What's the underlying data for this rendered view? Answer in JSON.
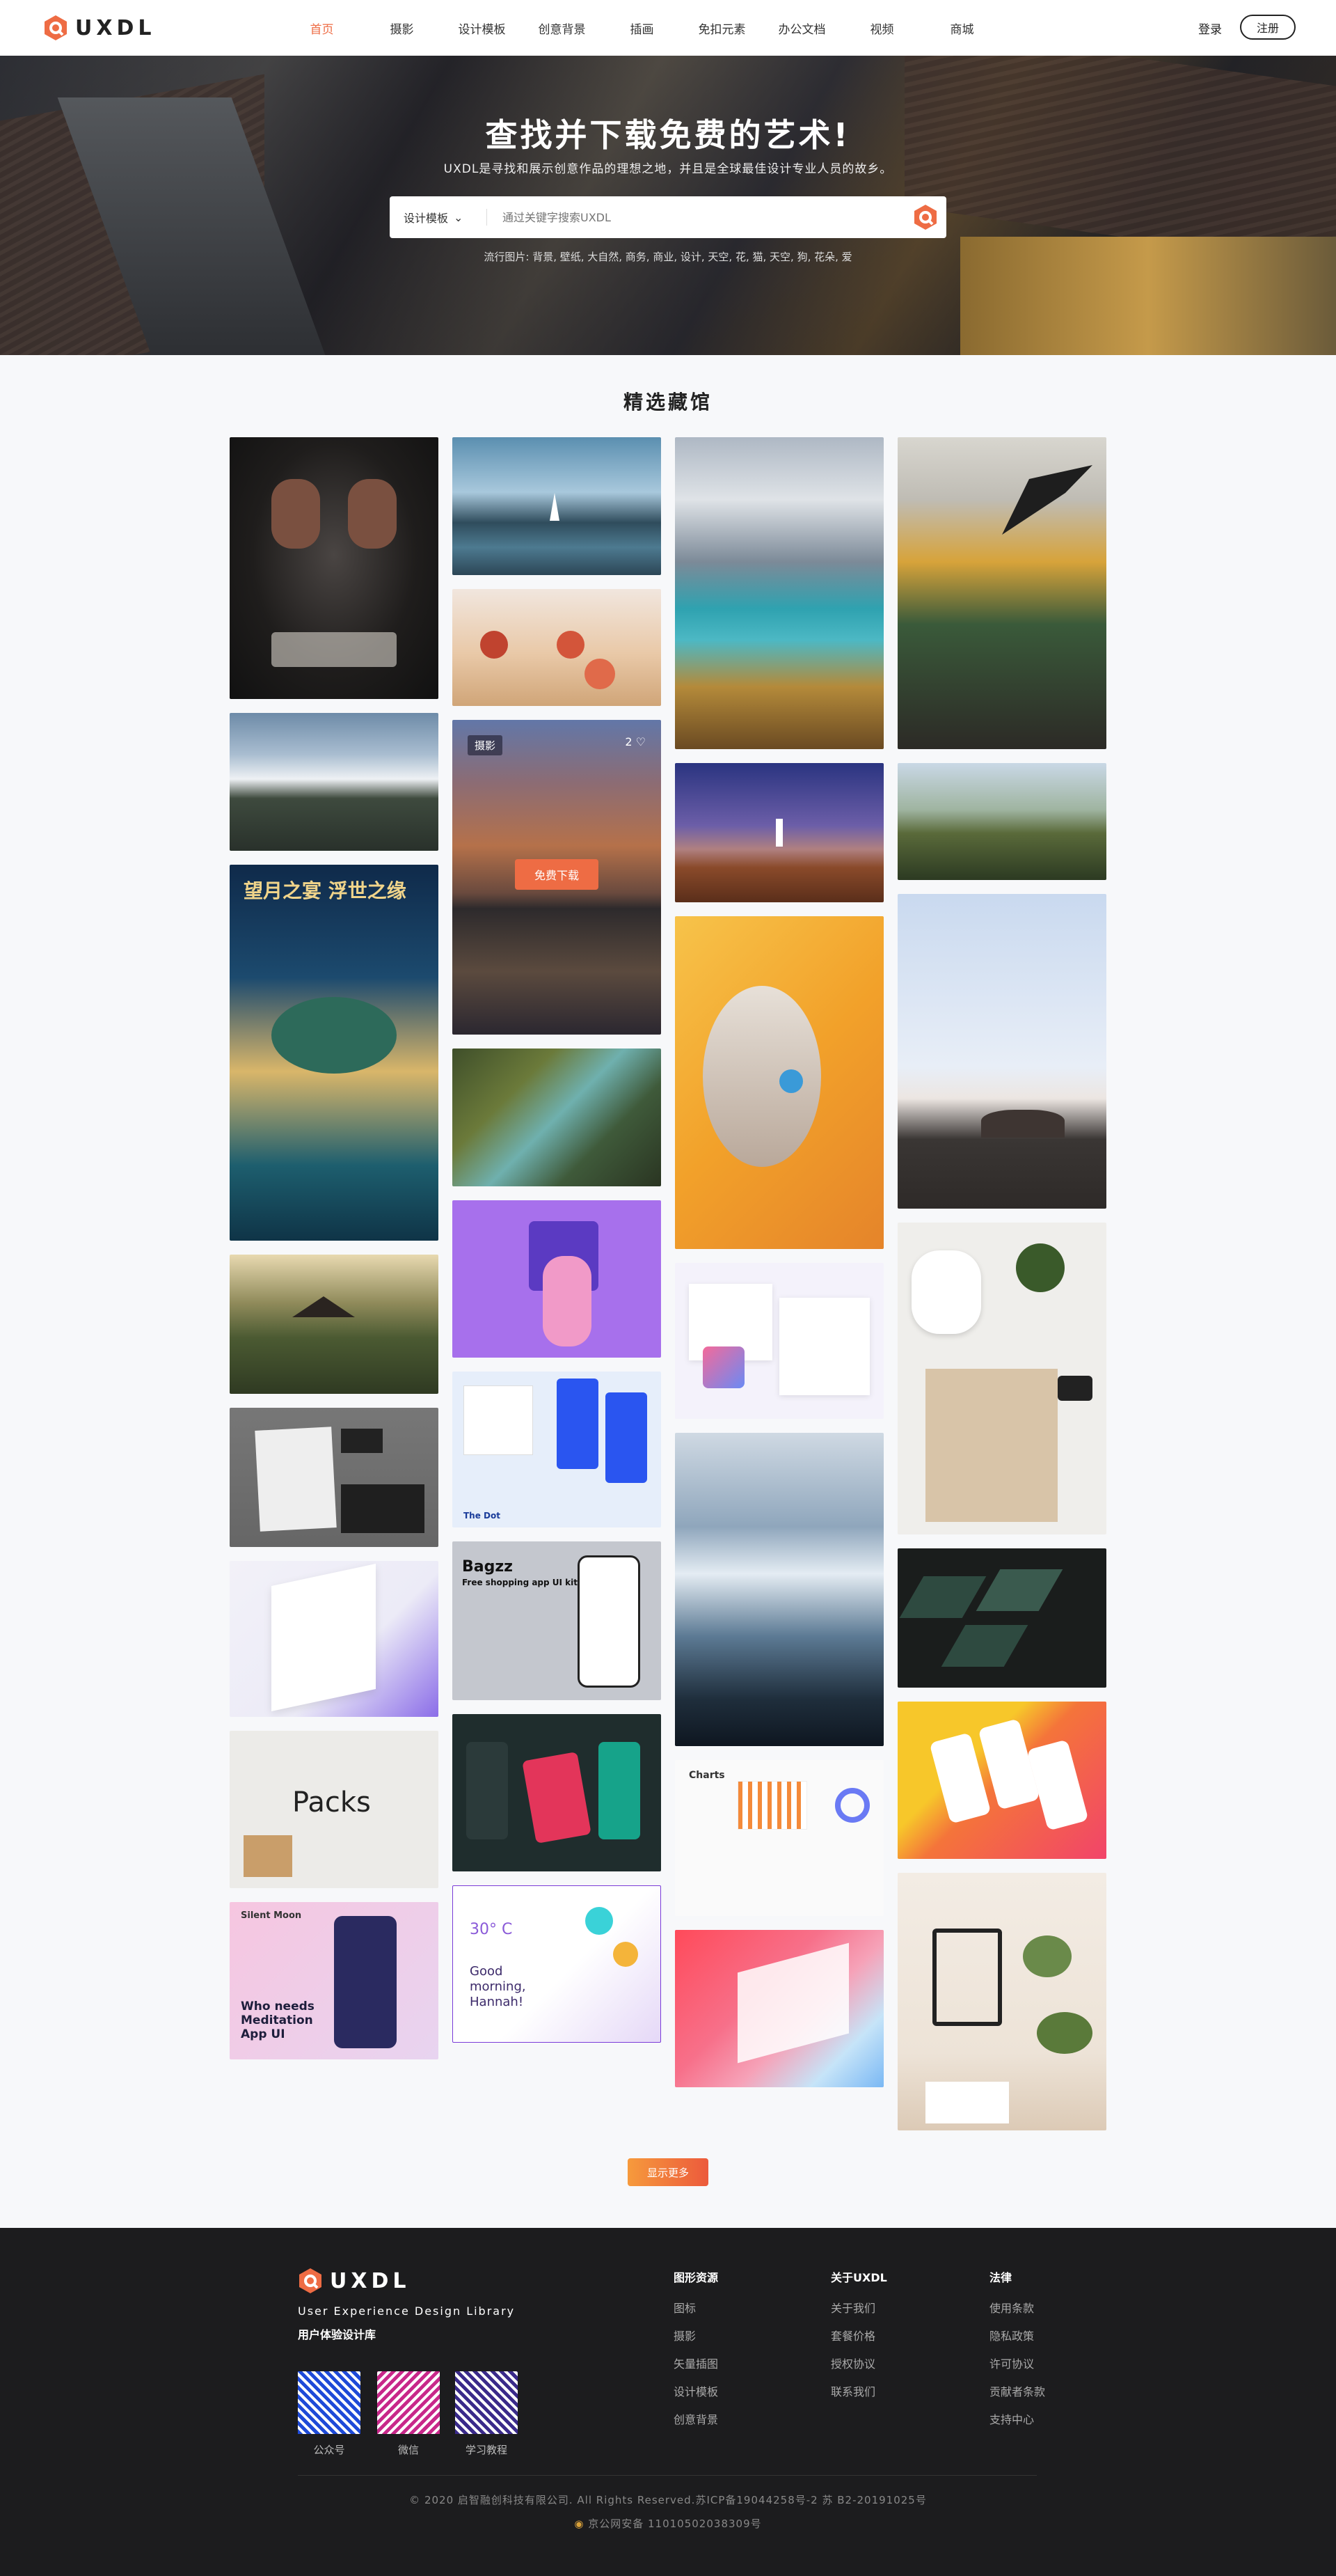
{
  "header": {
    "logo_text": "UXDL",
    "nav": [
      "首页",
      "摄影",
      "设计模板",
      "创意背景",
      "插画",
      "免扣元素",
      "办公文档",
      "视频",
      "商城"
    ],
    "login": "登录",
    "signup": "注册"
  },
  "hero": {
    "title": "查找并下载免费的艺术!",
    "subtitle": "UXDL是寻找和展示创意作品的理想之地，并且是全球最佳设计专业人员的故乡。",
    "search_category": "设计模板",
    "search_placeholder": "通过关键字搜索UXDL",
    "hot_label": "流行图片:",
    "hot_tags": "背景, 壁纸, 大自然, 商务, 商业, 设计, 天空, 花, 猫, 天空, 狗, 花朵, 爱"
  },
  "gallery": {
    "title": "精选藏馆",
    "hover_badge": "摄影",
    "hover_likes": "2",
    "hover_download": "免费下载",
    "tile_texts": {
      "poster_title": "望月之宴 浮世之缘",
      "packs": "Packs",
      "bagzz_title": "Bagzz",
      "bagzz_sub": "Free shopping app UI kit",
      "meditation_brand": "Silent Moon",
      "meditation": "Who needs Meditation App UI",
      "weather_temp": "30° C",
      "weather_greeting": "Good morning, Hannah!",
      "charts": "Charts",
      "dot": "The Dot"
    },
    "more_button": "显示更多"
  },
  "footer": {
    "logo_text": "UXDL",
    "tagline": "User Experience Design Library",
    "tagline_cn": "用户体验设计库",
    "qrs": [
      "公众号",
      "微信",
      "学习教程"
    ],
    "columns": [
      {
        "title": "图形资源",
        "items": [
          "图标",
          "摄影",
          "矢量插图",
          "设计模板",
          "创意背景"
        ]
      },
      {
        "title": "关于UXDL",
        "items": [
          "关于我们",
          "套餐价格",
          "授权协议",
          "联系我们"
        ]
      },
      {
        "title": "法律",
        "items": [
          "使用条款",
          "隐私政策",
          "许可协议",
          "贡献者条款",
          "支持中心"
        ]
      }
    ],
    "copyright": "© 2020 启智融创科技有限公司. All Rights Reserved.苏ICP备19044258号-2  苏 B2-20191025号",
    "icp": "京公网安备 11010502038309号"
  },
  "colors": {
    "accent": "#ee6c44",
    "footer_bg": "#1c1c1e"
  }
}
